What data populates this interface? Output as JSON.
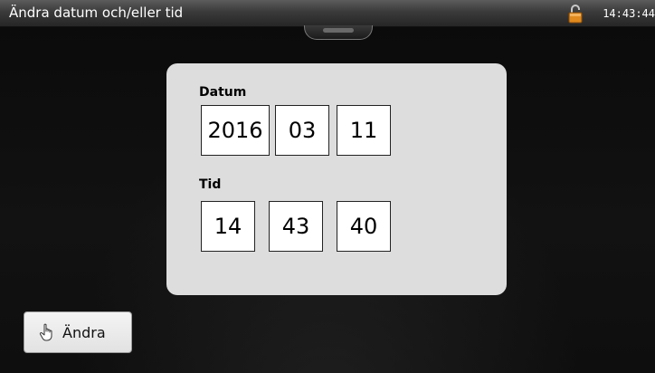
{
  "window": {
    "title": "Ändra datum och/eller tid",
    "clock": "14:43:44",
    "status_icon": "lock-open-icon"
  },
  "panel": {
    "date_label": "Datum",
    "date": {
      "year": "2016",
      "month": "03",
      "day": "11"
    },
    "time_label": "Tid",
    "time": {
      "hour": "14",
      "minute": "43",
      "second": "40"
    }
  },
  "actions": {
    "change_label": "Ändra",
    "change_icon": "hand-pointer-icon"
  },
  "colors": {
    "panel_bg": "#dddddd",
    "lock_accent": "#e08a1e"
  }
}
